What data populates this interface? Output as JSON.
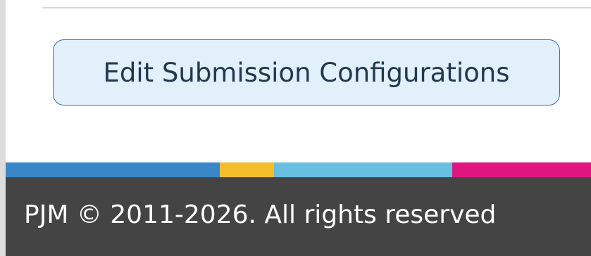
{
  "main": {
    "edit_button_label": "Edit Submission Configurations"
  },
  "footer": {
    "copyright": "PJM © 2011-2026. All rights reserved",
    "stripe_colors": [
      "#3a87c8",
      "#f4bd2a",
      "#68bfe0",
      "#e0157f"
    ]
  },
  "colors": {
    "button_bg": "#e1f0fb",
    "button_border": "#3d6f9f",
    "button_text": "#23384f",
    "footer_bg": "#444444",
    "footer_text": "#ffffff"
  }
}
